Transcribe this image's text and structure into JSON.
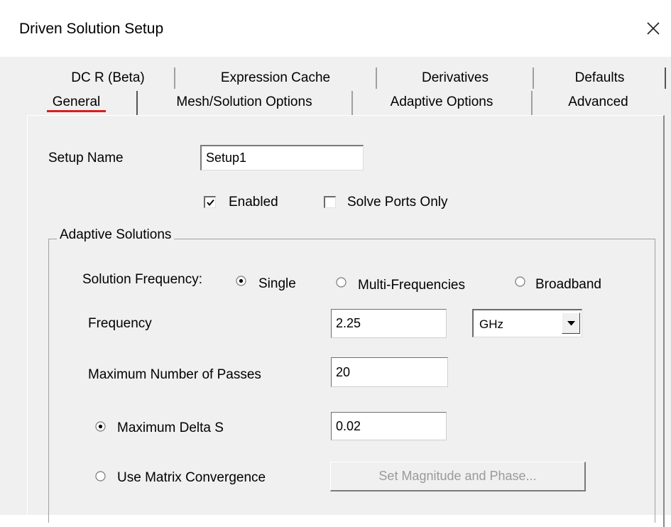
{
  "window": {
    "title": "Driven Solution Setup"
  },
  "tabs": {
    "back_row": [
      {
        "label": "DC R (Beta)"
      },
      {
        "label": "Expression Cache"
      },
      {
        "label": "Derivatives"
      },
      {
        "label": "Defaults"
      }
    ],
    "front_row": [
      {
        "label": "General",
        "active": true
      },
      {
        "label": "Mesh/Solution Options"
      },
      {
        "label": "Adaptive Options"
      },
      {
        "label": "Advanced"
      }
    ]
  },
  "general": {
    "setup_name_label": "Setup Name",
    "setup_name_value": "Setup1",
    "enabled_label": "Enabled",
    "enabled_checked": true,
    "solve_ports_only_label": "Solve Ports Only",
    "solve_ports_only_checked": false
  },
  "adaptive": {
    "group_label": "Adaptive Solutions",
    "solution_frequency_label": "Solution Frequency:",
    "frequency_modes": [
      {
        "label": "Single",
        "selected": true
      },
      {
        "label": "Multi-Frequencies",
        "selected": false
      },
      {
        "label": "Broadband",
        "selected": false
      }
    ],
    "frequency_label": "Frequency",
    "frequency_value": "2.25",
    "frequency_unit": "GHz",
    "max_passes_label": "Maximum Number of Passes",
    "max_passes_value": "20",
    "convergence": [
      {
        "label": "Maximum Delta S",
        "selected": true
      },
      {
        "label": "Use Matrix Convergence",
        "selected": false
      }
    ],
    "max_delta_s_value": "0.02",
    "set_magnitude_button": "Set Magnitude and Phase..."
  }
}
